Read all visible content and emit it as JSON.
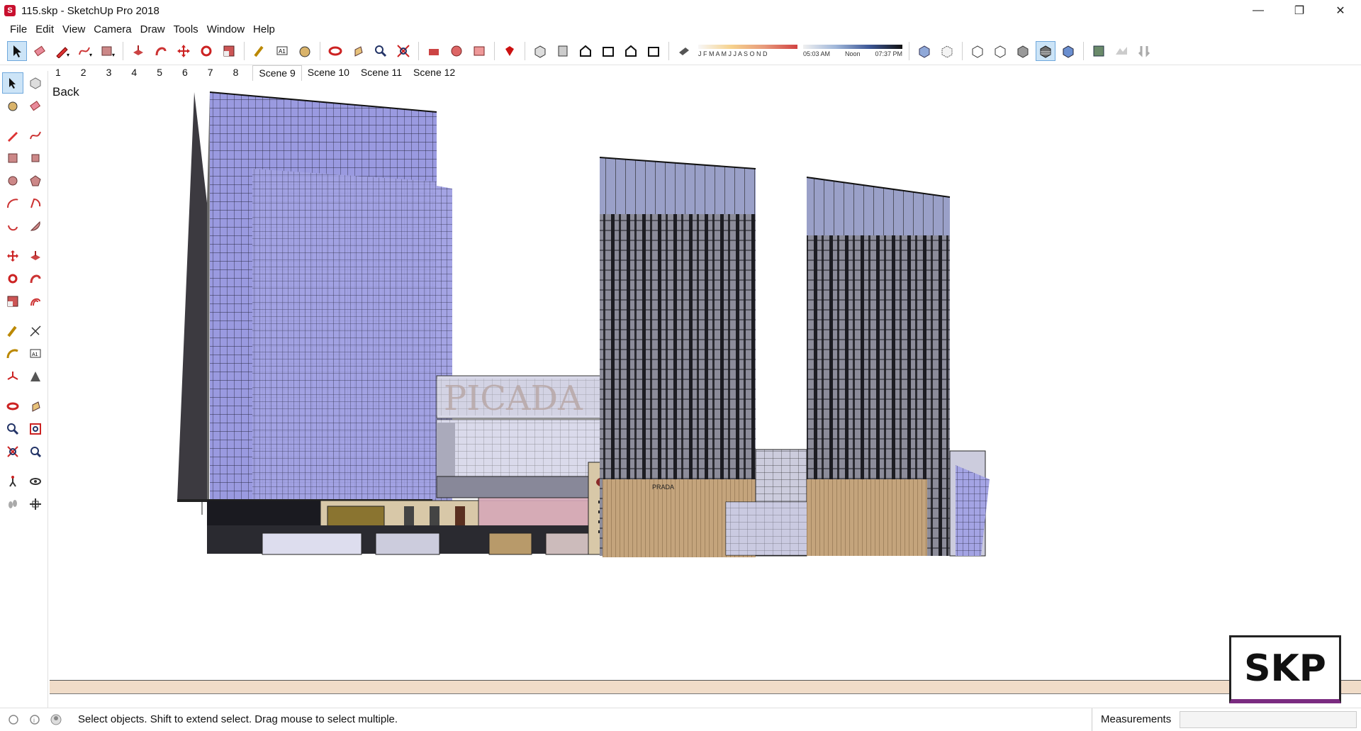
{
  "window": {
    "title": "115.skp - SketchUp Pro 2018",
    "controls": [
      "minimize",
      "restore",
      "close"
    ]
  },
  "menu": [
    "File",
    "Edit",
    "View",
    "Camera",
    "Draw",
    "Tools",
    "Window",
    "Help"
  ],
  "toolbar": {
    "groups": [
      [
        "select-icon",
        "eraser-icon",
        "pencil-icon",
        "freehand-icon",
        "rectangle-icon"
      ],
      [
        "push-pull-icon",
        "follow-me-icon",
        "move-icon",
        "rotate-icon",
        "scale-icon"
      ],
      [
        "tape-measure-icon",
        "text-icon",
        "paint-bucket-icon"
      ],
      [
        "orbit-icon",
        "pan-icon",
        "zoom-icon",
        "zoom-extents-icon"
      ],
      [
        "warehouse-icon",
        "extension-warehouse-icon",
        "layout-icon"
      ],
      [
        "ruby-icon"
      ],
      [
        "iso-view-icon",
        "top-view-icon",
        "front-view-icon",
        "right-view-icon",
        "back-view-icon",
        "left-view-icon"
      ],
      [
        "shadows-icon"
      ],
      [
        "xray-icon",
        "back-edges-icon",
        "wireframe-icon",
        "hidden-line-icon",
        "shaded-icon",
        "shaded-textures-icon",
        "monochrome-icon"
      ],
      [
        "add-location-icon",
        "toggle-terrain-icon",
        "sandbox-icon"
      ]
    ],
    "shadow_months": "J F M A M J J A S O N D",
    "shadow_time_start": "05:03 AM",
    "shadow_time_noon": "Noon",
    "shadow_time_end": "07:37 PM"
  },
  "scenes": [
    "1",
    "2",
    "3",
    "4",
    "5",
    "6",
    "7",
    "8",
    "Scene 9",
    "Scene 10",
    "Scene 11",
    "Scene 12"
  ],
  "active_scene": "Scene 9",
  "viewport": {
    "view_label": "Back",
    "sign_text": "PICADA",
    "brand_text": "PRADA"
  },
  "logo": "SKP",
  "status": {
    "text": "Select objects. Shift to extend select. Drag mouse to select multiple.",
    "measurements_label": "Measurements"
  },
  "colors": {
    "glass_blue": "#8f8fd8",
    "glass_dark": "#2c2c34",
    "stone": "#c7a77a",
    "ground": "#f0dcc8",
    "active_tab": "#cce4f7",
    "logo_accent": "#7a2b80"
  }
}
